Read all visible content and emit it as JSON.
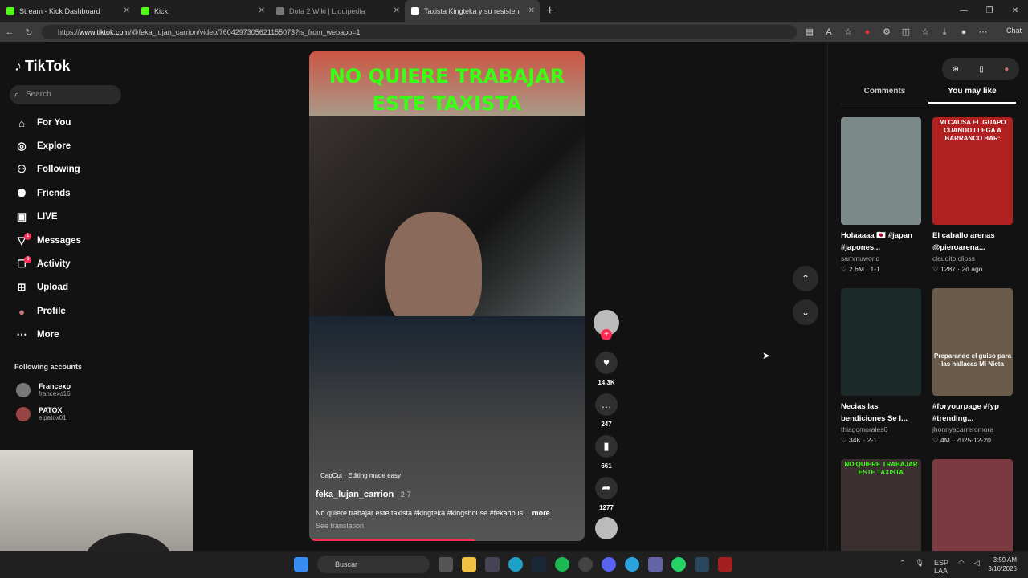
{
  "browser": {
    "tabs": [
      {
        "label": "Stream - Kick Dashboard",
        "color": "#53fc18"
      },
      {
        "label": "Kick",
        "color": "#53fc18"
      },
      {
        "label": "Dota 2 Wiki | Liquipedia",
        "color": "#777777"
      },
      {
        "label": "Taxista Kingteka y su resistenc",
        "color": "#ffffff"
      }
    ],
    "url_prefix": "https://",
    "url_host": "www.tiktok.com",
    "url_path": "/@feka_lujan_carrion/video/7604297305621155073?is_from_webapp=1",
    "chat_label": "Chat"
  },
  "tiktok": {
    "logo": "TikTok",
    "search_placeholder": "Search",
    "nav": [
      {
        "label": "For You",
        "icon": "home-icon"
      },
      {
        "label": "Explore",
        "icon": "compass-icon"
      },
      {
        "label": "Following",
        "icon": "following-icon"
      },
      {
        "label": "Friends",
        "icon": "friends-icon"
      },
      {
        "label": "LIVE",
        "icon": "live-icon"
      },
      {
        "label": "Messages",
        "icon": "messages-icon",
        "badge": "1"
      },
      {
        "label": "Activity",
        "icon": "activity-icon",
        "badge": "6"
      },
      {
        "label": "Upload",
        "icon": "upload-icon"
      },
      {
        "label": "Profile",
        "icon": "profile-icon"
      },
      {
        "label": "More",
        "icon": "more-icon"
      }
    ],
    "following_title": "Following accounts",
    "accounts": [
      {
        "name": "Francexo",
        "handle": "francexo16"
      },
      {
        "name": "PATOX",
        "handle": "elpatox01"
      }
    ],
    "video": {
      "caption_line1": "NO QUIERE TRABAJAR",
      "caption_line2": "ESTE TAXISTA",
      "capcut": "CapCut · Editing made easy",
      "author": "feka_lujan_carrion",
      "date": "· 2-7",
      "description": "No quiere trabajar este taxista #kingteka #kingshouse #fekahous...",
      "more": "more",
      "see_translation": "See translation",
      "progress": 0.6
    },
    "actions": {
      "likes": "14.3K",
      "comments": "247",
      "saves": "661",
      "shares": "1277"
    },
    "right": {
      "tab_comments": "Comments",
      "tab_you_may_like": "You may like",
      "cards": [
        {
          "title": "Holaaaaa 🇯🇵 #japan #japones...",
          "user": "sammuworld",
          "likes": "2.6M",
          "date": "1-1",
          "overlay": "",
          "thumb": "#7b8a88"
        },
        {
          "title": "El caballo arenas @pieroarena...",
          "user": "claudito.clipss",
          "likes": "1287",
          "date": "2d ago",
          "overlay": "MI CAUSA EL GUAPO CUANDO LLEGA A BARRANCO BAR:",
          "thumb": "#b0201e"
        },
        {
          "title": "Necias las bendiciones Se l...",
          "user": "thiagomorales6",
          "likes": "34K",
          "date": "2-1",
          "overlay": "",
          "thumb": "#1d2a2a"
        },
        {
          "title": "#foryourpage #fyp #trending...",
          "user": "jhonnyacarreromora",
          "likes": "4M",
          "date": "2025-12-20",
          "overlay": "Preparando el guiso para las hallacas Mi Nieta",
          "thumb": "#6a5a4a"
        },
        {
          "title": "",
          "user": "",
          "likes": "",
          "date": "",
          "overlay": "NO QUIERE TRABAJAR ESTE TAXISTA",
          "thumb": "#3a3030"
        },
        {
          "title": "",
          "user": "",
          "likes": "",
          "date": "",
          "overlay": "",
          "thumb": "#7a3a40"
        }
      ]
    }
  },
  "taskbar": {
    "search": "Buscar",
    "lang1": "ESP",
    "lang2": "LAA",
    "time": "3:59 AM",
    "date": "3/16/2026"
  }
}
